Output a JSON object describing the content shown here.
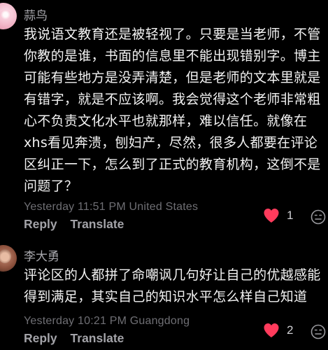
{
  "comments": [
    {
      "username": "蒜鸟",
      "lines": [
        "我说语文教育还是被轻视了。只要是当老师，不管",
        "你教的是谁，书面的信息里不能出现错别字。博主",
        "可能有些地方是没弄清楚，但是老师的文本里就是",
        "有错字，就是不应该啊。我会觉得这个老师非常粗",
        "心不负责文化水平也就那样，难以信任。就像在",
        "xhs看见奔溃，刨妇产，尽然，很多人都要在评论",
        "区纠正一下，怎么到了正式的教育机构，这倒不是",
        "问题了？"
      ],
      "timestamp": "Yesterday 11:51 PM United States",
      "reply_label": "Reply",
      "translate_label": "Translate",
      "likes": "1"
    },
    {
      "username": "李大勇",
      "lines": [
        "评论区的人都拼了命嘲讽几句好让自己的优越感能",
        "得到满足，其实自己的知识水平怎么样自己知道"
      ],
      "timestamp": "Yesterday 10:21 PM Guangdong",
      "reply_label": "Reply",
      "translate_label": "Translate",
      "likes": "2"
    }
  ],
  "colors": {
    "heart": "#ff3b5c",
    "background": "#000000"
  },
  "icons": {
    "like": "heart-icon",
    "reaction": "emoji-reaction-icon"
  }
}
